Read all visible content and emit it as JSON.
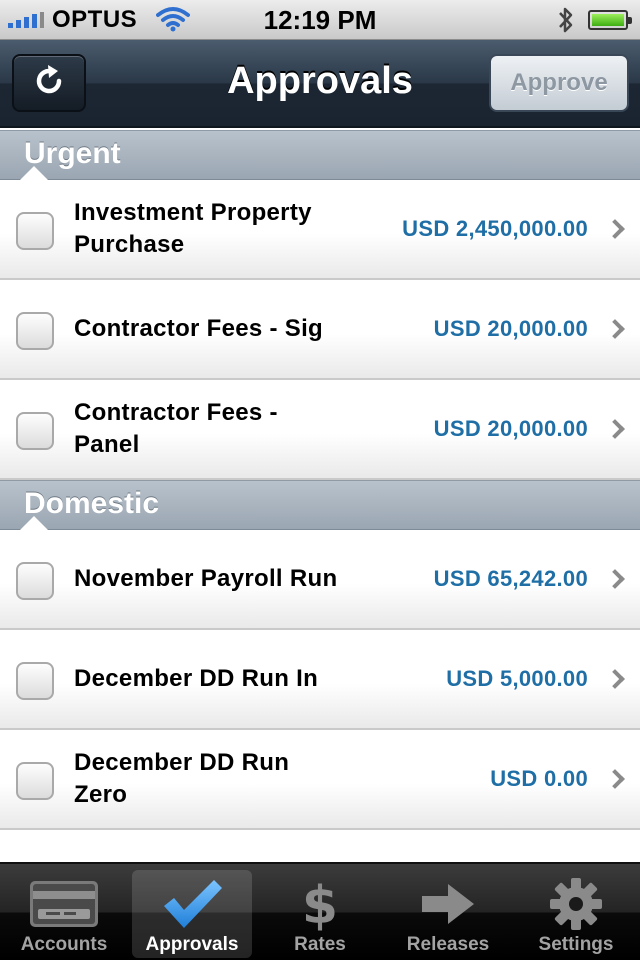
{
  "status_bar": {
    "carrier": "OPTUS",
    "time": "12:19 PM"
  },
  "nav": {
    "title": "Approvals",
    "approve_label": "Approve",
    "refresh_icon": "refresh-icon"
  },
  "sections": [
    {
      "title": "Urgent",
      "items": [
        {
          "title": "Investment Property Purchase",
          "amount": "USD 2,450,000.00"
        },
        {
          "title": "Contractor Fees - Sig",
          "amount": "USD 20,000.00"
        },
        {
          "title": "Contractor Fees - Panel",
          "amount": "USD 20,000.00"
        }
      ]
    },
    {
      "title": "Domestic",
      "items": [
        {
          "title": "November Payroll Run",
          "amount": "USD 65,242.00"
        },
        {
          "title": "December DD Run In",
          "amount": "USD 5,000.00"
        },
        {
          "title": "December DD Run Zero",
          "amount": "USD 0.00"
        }
      ]
    }
  ],
  "tabs": [
    {
      "label": "Accounts",
      "icon": "card-icon"
    },
    {
      "label": "Approvals",
      "icon": "checkmark-icon"
    },
    {
      "label": "Rates",
      "icon": "dollar-icon"
    },
    {
      "label": "Releases",
      "icon": "arrow-right-icon"
    },
    {
      "label": "Settings",
      "icon": "gear-icon"
    }
  ],
  "colors": {
    "amount": "#1f6fa6",
    "active_tab_icon": "#3b9ae8"
  }
}
